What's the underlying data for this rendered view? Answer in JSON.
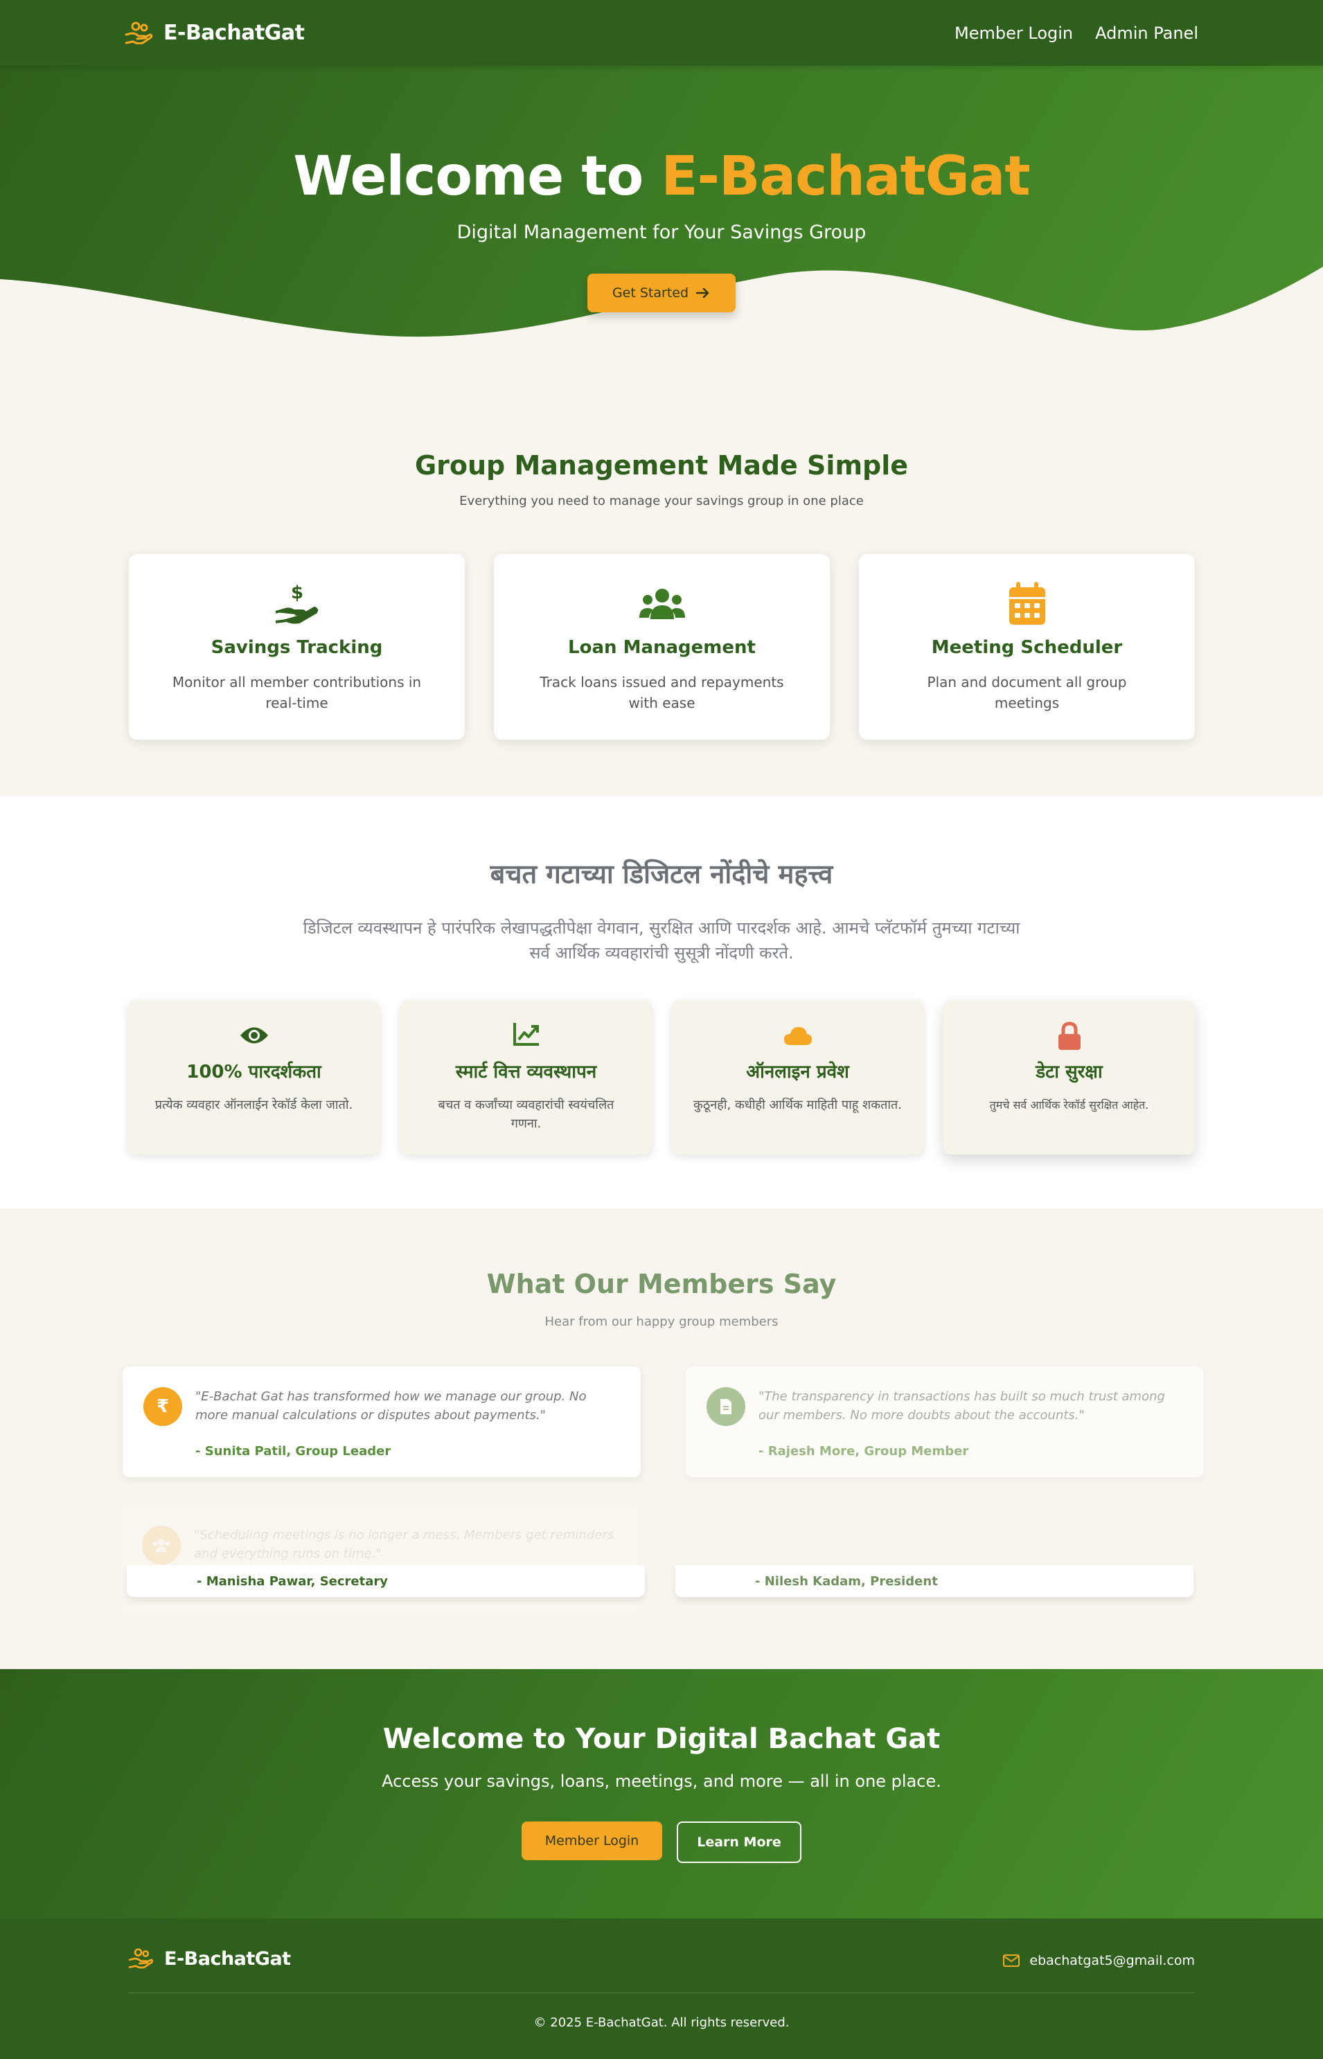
{
  "nav": {
    "brand": "E-BachatGat",
    "links": [
      "Member Login",
      "Admin Panel"
    ]
  },
  "hero": {
    "title_prefix": "Welcome to ",
    "title_accent": "E-BachatGat",
    "subtitle": "Digital Management for Your Savings Group",
    "cta": "Get Started"
  },
  "features": {
    "title": "Group Management Made Simple",
    "subtitle": "Everything you need to manage your savings group in one place",
    "cards": [
      {
        "icon": "hand-dollar-icon",
        "title": "Savings Tracking",
        "desc": "Monitor all member contributions in real-time"
      },
      {
        "icon": "users-icon",
        "title": "Loan Management",
        "desc": "Track loans issued and repayments with ease"
      },
      {
        "icon": "calendar-icon",
        "title": "Meeting Scheduler",
        "desc": "Plan and document all group meetings"
      }
    ]
  },
  "importance": {
    "title": "बचत गटाच्या डिजिटल नोंदीचे महत्त्व",
    "desc": "डिजिटल व्यवस्थापन हे पारंपरिक लेखापद्धतीपेक्षा वेगवान, सुरक्षित आणि पारदर्शक आहे. आमचे प्लॅटफॉर्म तुमच्या गटाच्या सर्व आर्थिक व्यवहारांची सुसूत्री नोंदणी करते.",
    "cards": [
      {
        "icon": "eye-icon",
        "color": "#2f5f1c",
        "title": "100% पारदर्शकता",
        "desc": "प्रत्येक व्यवहार ऑनलाईन रेकॉर्ड केला जातो."
      },
      {
        "icon": "chart-line-icon",
        "color": "#3c7a24",
        "title": "स्मार्ट वित्त व्यवस्थापन",
        "desc": "बचत व कर्जांच्या व्यवहारांची स्वयंचलित गणना."
      },
      {
        "icon": "cloud-icon",
        "color": "#f5a623",
        "title": "ऑनलाइन प्रवेश",
        "desc": "कुठूनही, कधीही आर्थिक माहिती पाहू शकतात."
      },
      {
        "icon": "lock-icon",
        "color": "#e06b55",
        "title": "डेटा सुरक्षा",
        "desc": "तुमचे सर्व आर्थिक रेकॉर्ड सुरक्षित आहेत."
      }
    ]
  },
  "testimonials": {
    "title": "What Our Members Say",
    "subtitle": "Hear from our happy group members",
    "items": [
      {
        "quote": "\"E-Bachat Gat has transformed how we manage our group. No more manual calculations or disputes about payments.\"",
        "author": "- Sunita Patil, Group Leader",
        "avatar": "₹",
        "avatar_color": "#f5a623"
      },
      {
        "quote": "\"The transparency in transactions has built so much trust among our members. No more doubts about the accounts.\"",
        "author": "- Rajesh More, Group Member",
        "avatar_color": "#7aa55e"
      },
      {
        "quote": "\"Scheduling meetings is no longer a mess. Members get reminders and everything runs on time.\"",
        "author": "- Manisha Pawar, Secretary",
        "avatar_color": "#f5a623"
      },
      {
        "author": "- Nilesh Kadam, President"
      }
    ]
  },
  "cta": {
    "title": "Welcome to Your Digital Bachat Gat",
    "subtitle": "Access your savings, loans, meetings, and more — all in one place.",
    "login": "Member Login",
    "learn": "Learn More"
  },
  "footer": {
    "brand": "E-BachatGat",
    "email": "ebachatgat5@gmail.com",
    "copyright": "© 2025 E-BachatGat. All rights reserved."
  },
  "colors": {
    "primary": "#2f5f1c",
    "accent": "#f5a623",
    "cream": "#f8f5ee"
  }
}
